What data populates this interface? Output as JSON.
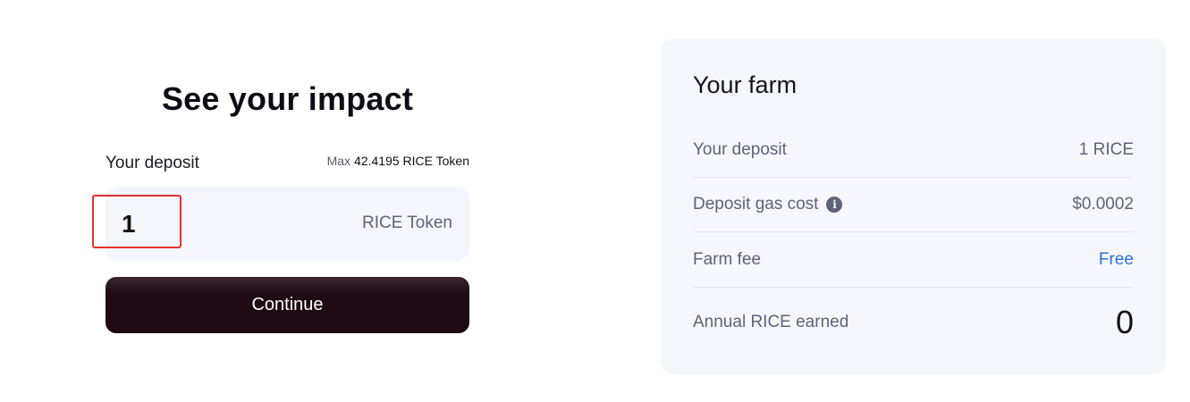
{
  "impact": {
    "title": "See your impact",
    "deposit_label": "Your deposit",
    "max_prefix": "Max",
    "max_value": "42.4195 RICE Token",
    "amount_value": "1",
    "token_suffix": "RICE Token",
    "continue_label": "Continue"
  },
  "farm": {
    "title": "Your farm",
    "rows": [
      {
        "label": "Your deposit",
        "value": "1 RICE"
      },
      {
        "label": "Deposit gas cost",
        "value": "$0.0002",
        "icon": "info-icon"
      },
      {
        "label": "Farm fee",
        "value": "Free"
      },
      {
        "label": "Annual RICE earned",
        "value": "0"
      }
    ]
  },
  "colors": {
    "button_bg": "#1e0a13",
    "input_bg": "#f5f6fb",
    "card_bg": "#f6f7fc",
    "free_link": "#2f6fe0",
    "highlight": "#e3322e"
  }
}
